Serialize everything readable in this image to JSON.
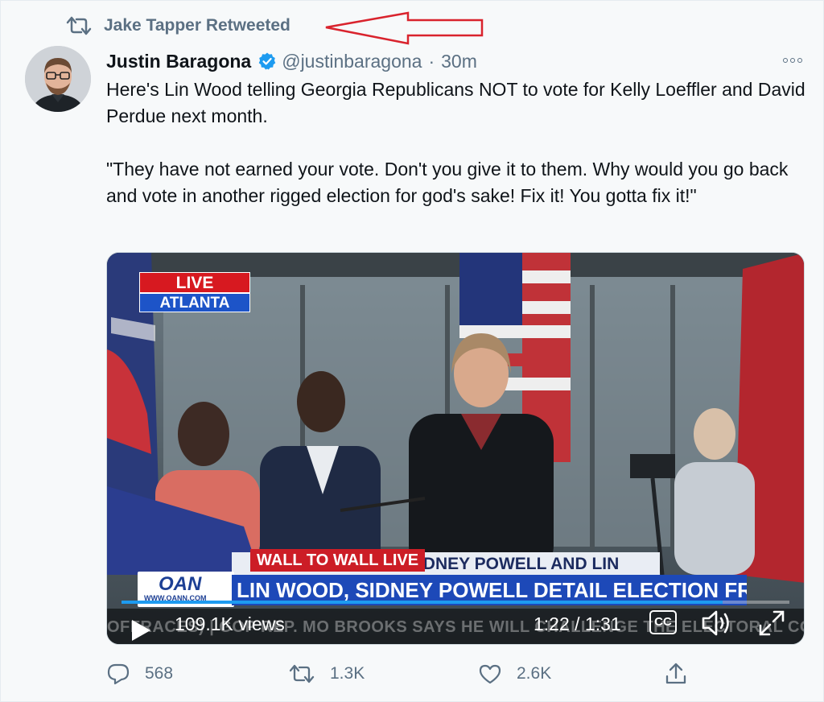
{
  "context": {
    "label": "Jake Tapper Retweeted",
    "icon": "retweet-icon"
  },
  "annotation": {
    "color": "#d9232d",
    "icon": "arrow-left-outline"
  },
  "author": {
    "name": "Justin Baragona",
    "handle": "@justinbaragona",
    "separator": "·",
    "time": "30m",
    "verified": true,
    "verified_color": "#1d9bf0"
  },
  "tweet": {
    "paragraphs": [
      "Here's Lin Wood telling Georgia Republicans NOT to vote for Kelly Loeffler and David Perdue next month.",
      "\"They have not earned your vote. Don't you give it to them. Why would you go back and vote in another rigged election for god's sake! Fix it! You gotta fix it!\""
    ]
  },
  "video": {
    "bug_live": "LIVE",
    "bug_city": "ATLANTA",
    "banner": "WALL TO WALL LIVE",
    "lower_third_top": "LI      YS SIDNEY POWELL AND LIN",
    "headline": "LIN WOOD, SIDNEY POWELL DETAIL ELECTION FRAUD IN GA.",
    "network_logo": "OAN",
    "network_site": "WWW.OANN.COM",
    "ticker": "OFFRACES) | GOP REP. MO BROOKS SAYS HE WILL CHALLENGE THE ELECTORAL COL",
    "views": "109.1K views",
    "elapsed": "1:22 / 1:31",
    "progress": 0.9,
    "cc_label": "CC"
  },
  "actions": {
    "reply": {
      "icon": "reply-icon",
      "count": "568"
    },
    "retweet": {
      "icon": "retweet-icon",
      "count": "1.3K"
    },
    "like": {
      "icon": "heart-icon",
      "count": "2.6K"
    },
    "share": {
      "icon": "share-icon",
      "count": ""
    }
  },
  "colors": {
    "secondary_text": "#5b7083",
    "accent": "#1d9bf0"
  }
}
